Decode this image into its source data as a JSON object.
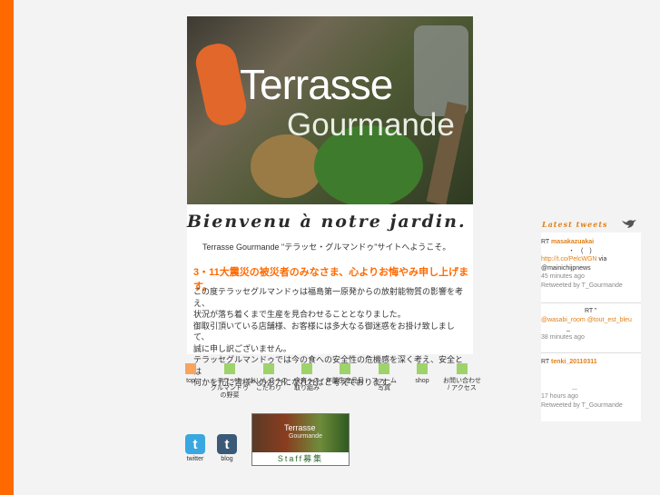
{
  "colors": {
    "accent": "#ff6a00",
    "tweet_accent": "#e08018",
    "green": "#9ed26a",
    "orange_square": "#f7a45f"
  },
  "hero": {
    "title": "Terrasse",
    "subtitle": "Gourmande"
  },
  "intro": {
    "heading": "Bienvenu à notre jardin.",
    "welcome": "Terrasse Gourmande \"テラッセ・グルマンドゥ\"サイトへようこそ。",
    "condolence": "3・11大震災の被災者のみなさま、心よりお悔やみ申し上げます。",
    "body": [
      "この度テラッセグルマンドゥは福島第一原発からの放射能物質の影響を考え、",
      "状況が落ち着くまで生産を見合わせることとなりました。",
      "御取引頂いている店舗様、お客様には多大なる御迷惑をお掛け致しまして、",
      "誠に申し訳ございません。",
      "テラッセグルマンドゥでは今の食への安全性の危機感を深く考え、安全とは",
      "何かを元に皆様へのお力になれればと考えております。"
    ]
  },
  "nav": [
    {
      "label": "top",
      "color": "#f7a45f"
    },
    {
      "label": "テラッセ\nグルマンドゥ\nの野菜",
      "color": "#9ed26a"
    },
    {
      "label": "おいしさへの\nこだわり",
      "color": "#9ed26a"
    },
    {
      "label": "食育への\n取り組み",
      "color": "#9ed26a"
    },
    {
      "label": "年間生産品目",
      "color": "#9ed26a"
    },
    {
      "label": "ファーム\n写真",
      "color": "#9ed26a"
    },
    {
      "label": "shop",
      "color": "#9ed26a"
    },
    {
      "label": "お問い合わせ\n/ アクセス",
      "color": "#9ed26a"
    }
  ],
  "social": {
    "twitter": {
      "label": "twitter",
      "icon": "twitter-icon"
    },
    "blog": {
      "label": "blog",
      "icon": "tumblr-icon"
    }
  },
  "staff": {
    "title": "Terrasse",
    "subtitle": "Gourmande",
    "button": "Staff募集"
  },
  "tweets": {
    "title": "Latest tweets",
    "items": [
      {
        "rt": "RT",
        "user": "masakazuakai",
        "line2": "・　(　)",
        "link": "http://t.co/PelcWGN",
        "via": "via",
        "via_user": "@mainichijpnews",
        "time": "45 minutes ago",
        "retweet": "Retweeted by T_Gourmande"
      },
      {
        "rt": "RT \"",
        "user1": "@wasabi_room",
        "user2": "@tout_est_bleu",
        "dash": "_",
        "time": "38 minutes ago"
      },
      {
        "rt": "RT",
        "user": "tenki_20110311",
        "dots": "...",
        "time": "17 hours ago",
        "retweet": "Retweeted by T_Gourmande"
      }
    ]
  }
}
